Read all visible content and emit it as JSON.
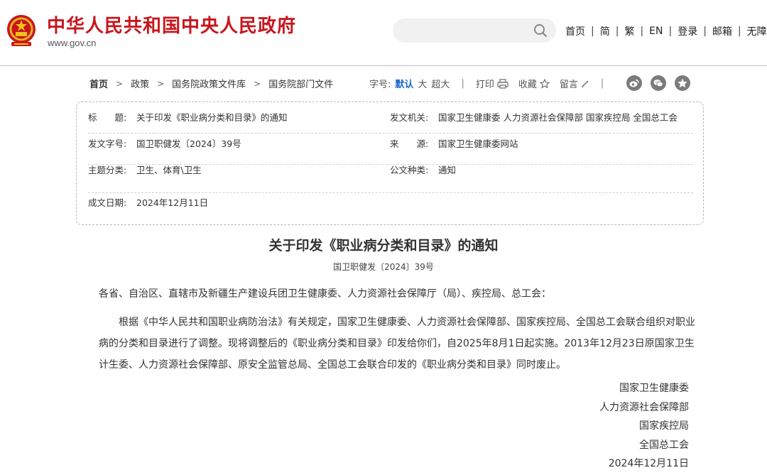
{
  "header": {
    "site_title": "中华人民共和国中央人民政府",
    "site_url": "www.gov.cn",
    "search": {
      "placeholder": ""
    },
    "nav": [
      "首页",
      "简",
      "繁",
      "EN",
      "登录",
      "邮箱",
      "无障碍"
    ]
  },
  "breadcrumb": [
    "首页",
    "政策",
    "国务院政策文件库",
    "国务院部门文件"
  ],
  "tools": {
    "font_label": "字号:",
    "font_sizes": [
      "默认",
      "大",
      "超大"
    ],
    "print": "打印",
    "favorite": "收藏",
    "comment": "留言"
  },
  "meta": {
    "title_label": "标　　题:",
    "title_value": "关于印发《职业病分类和目录》的通知",
    "issuer_label": "发文机关:",
    "issuer_value": "国家卫生健康委  人力资源社会保障部  国家疾控局  全国总工会",
    "docno_label": "发文字号:",
    "docno_value": "国卫职健发〔2024〕39号",
    "source_label": "来　　源:",
    "source_value": "国家卫生健康委网站",
    "topic_label": "主题分类:",
    "topic_value": "卫生、体育\\卫生",
    "type_label": "公文种类:",
    "type_value": "通知",
    "date_label": "成文日期:",
    "date_value": "2024年12月11日"
  },
  "article": {
    "title": "关于印发《职业病分类和目录》的通知",
    "docno": "国卫职健发〔2024〕39号",
    "salutation": "各省、自治区、直辖市及新疆生产建设兵团卫生健康委、人力资源社会保障厅（局）、疾控局、总工会：",
    "body": "根据《中华人民共和国职业病防治法》有关规定，国家卫生健康委、人力资源社会保障部、国家疾控局、全国总工会联合组织对职业病的分类和目录进行了调整。现将调整后的《职业病分类和目录》印发给你们，自2025年8月1日起实施。2013年12月23日原国家卫生计生委、人力资源社会保障部、原安全监管总局、全国总工会联合印发的《职业病分类和目录》同时废止。",
    "signatures": [
      "国家卫生健康委",
      "人力资源社会保障部",
      "国家疾控局",
      "全国总工会",
      "2024年12月11日"
    ]
  },
  "colors": {
    "brand_red": "#c8161d",
    "active_blue": "#1a66c9"
  }
}
